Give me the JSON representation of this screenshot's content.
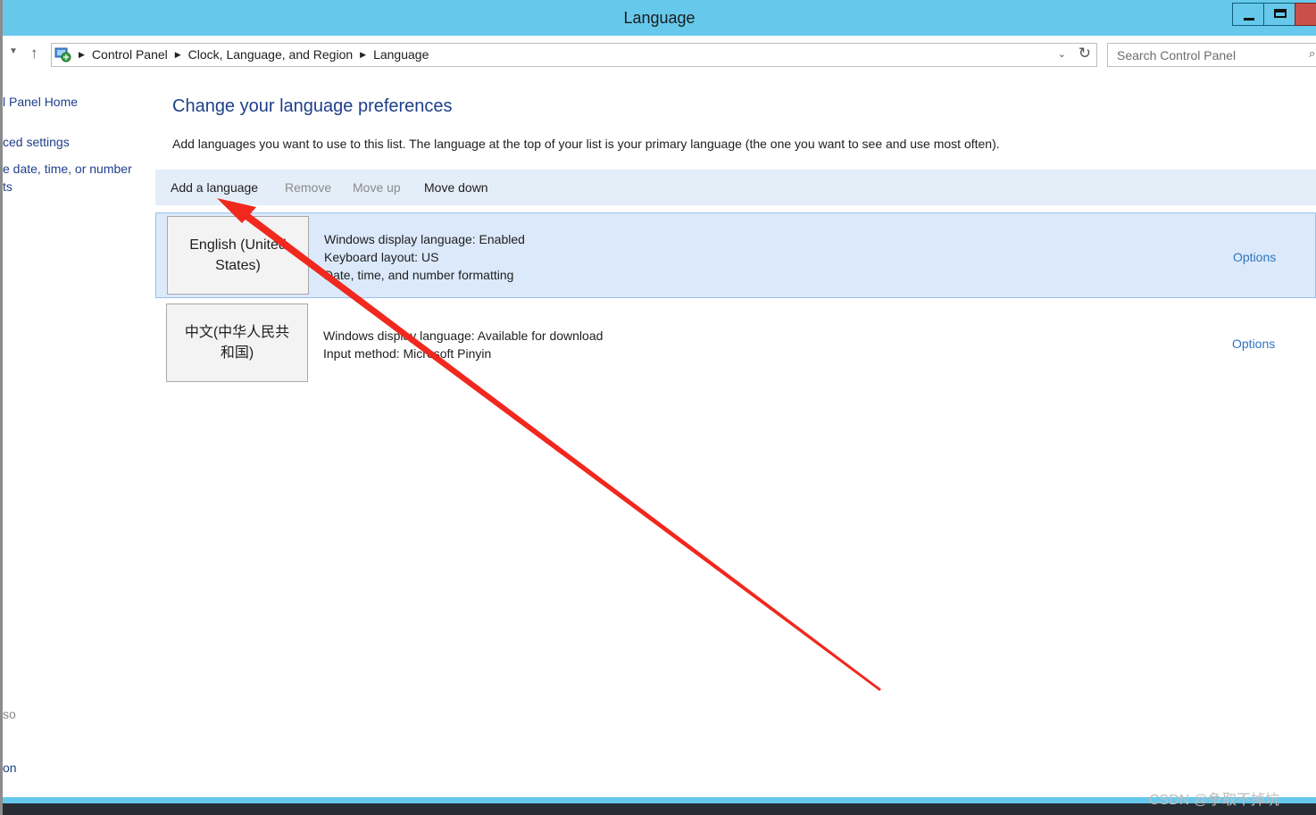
{
  "window": {
    "title": "Language"
  },
  "navbar": {
    "breadcrumbs": [
      "Control Panel",
      "Clock, Language, and Region",
      "Language"
    ],
    "search_placeholder": "Search Control Panel"
  },
  "sidebar": {
    "home_label": "l Panel Home",
    "advanced_label": "ced settings",
    "datetime_line1": "e date, time, or number",
    "datetime_line2": "ts",
    "bottom_label1": "so",
    "bottom_label2": "on"
  },
  "main": {
    "title": "Change your language preferences",
    "description": "Add languages you want to use to this list. The language at the top of your list is your primary language (the one you want to see and use most often).",
    "toolbar": {
      "add_label": "Add a language",
      "remove_label": "Remove",
      "move_up_label": "Move up",
      "move_down_label": "Move down"
    },
    "languages": [
      {
        "name_line1": "English (United",
        "name_line2": "States)",
        "details": [
          "Windows display language: Enabled",
          "Keyboard layout: US",
          "Date, time, and number formatting"
        ],
        "options_label": "Options"
      },
      {
        "name_line1": "中文(中华人民共",
        "name_line2": "和国)",
        "details": [
          "Windows display language: Available for download",
          "Input method: Microsoft Pinyin"
        ],
        "options_label": "Options"
      }
    ]
  },
  "watermark": "CSDN @争取不掉坑",
  "colors": {
    "titlebar": "#66c9ec",
    "link": "#1e3f8a",
    "options_link": "#2f75c0",
    "selection": "#dbe9fb",
    "annotation_arrow": "#f0281e"
  }
}
